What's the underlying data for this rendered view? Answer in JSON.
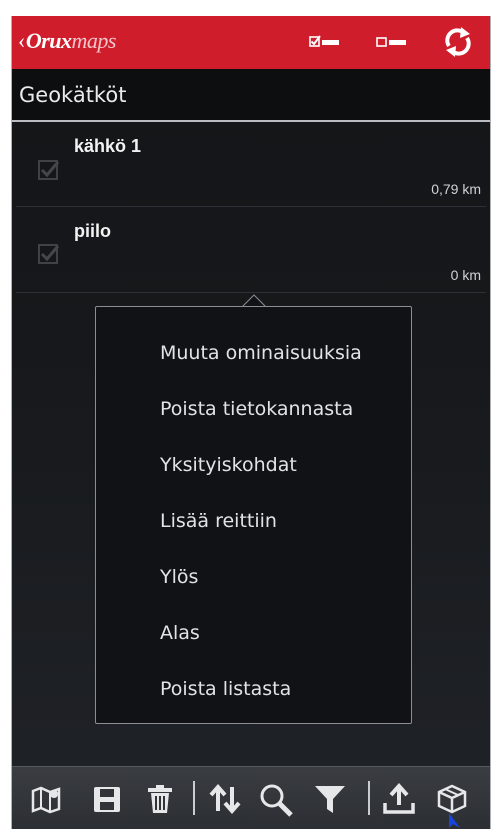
{
  "app": {
    "logo_prefix": "Orux",
    "logo_suffix": "maps"
  },
  "actionbar": {
    "icons": [
      "select-all-icon",
      "deselect-all-icon",
      "sync-icon"
    ],
    "accent": "#cf1d2c"
  },
  "list": {
    "title": "Geokätköt",
    "items": [
      {
        "name": "kähkö 1",
        "distance": "0,79 km",
        "checked": true
      },
      {
        "name": "piilo",
        "distance": "0 km",
        "checked": true
      }
    ]
  },
  "context_menu": {
    "items": [
      "Muuta ominaisuuksia",
      "Poista tietokannasta",
      "Yksityiskohdat",
      "Lisää reittiin",
      "Ylös",
      "Alas",
      "Poista listasta"
    ]
  },
  "bottom_toolbar": {
    "icons": [
      "map-icon",
      "save-icon",
      "trash-icon",
      "sort-icon",
      "search-icon",
      "filter-icon",
      "upload-icon",
      "package-icon"
    ]
  }
}
